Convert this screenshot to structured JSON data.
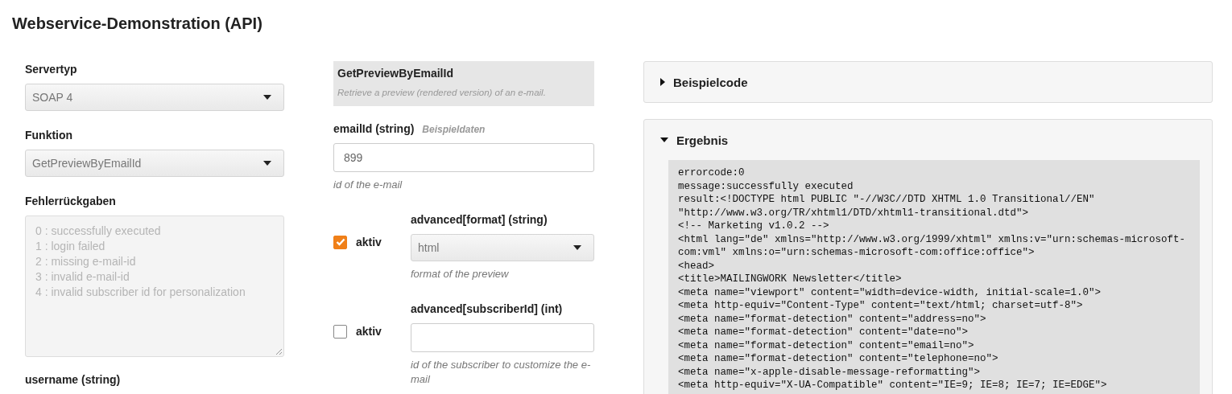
{
  "title": "Webservice-Demonstration (API)",
  "server_type": {
    "label": "Servertyp",
    "value": "SOAP 4"
  },
  "function": {
    "label": "Funktion",
    "value": "GetPreviewByEmailId"
  },
  "errors": {
    "label": "Fehlerrückgaben",
    "lines": [
      "0 : successfully executed",
      "1 : login failed",
      "2 : missing e-mail-id",
      "3 : invalid e-mail-id",
      "4 : invalid subscriber id for personalization"
    ]
  },
  "next_label": "username (string)",
  "function_card": {
    "name": "GetPreviewByEmailId",
    "description": "Retrieve a preview (rendered version) of an e-mail."
  },
  "params": [
    {
      "kind": "input",
      "label": "emailId (string)",
      "sample_link": "Beispieldaten",
      "value": "899",
      "hint": "id of the e-mail"
    },
    {
      "kind": "select",
      "active": {
        "label": "aktiv",
        "checked": true
      },
      "label": "advanced[format] (string)",
      "value": "html",
      "hint": "format of the preview"
    },
    {
      "kind": "input",
      "active": {
        "label": "aktiv",
        "checked": false
      },
      "label": "advanced[subscriberId] (int)",
      "hint": "id of the subscriber to customize the e-mail"
    }
  ],
  "panels": [
    {
      "title": "Beispielcode",
      "expanded": false
    },
    {
      "title": "Ergebnis",
      "expanded": true,
      "code_lines": [
        "errorcode:0",
        "message:successfully executed",
        "result:<!DOCTYPE html PUBLIC \"-//W3C//DTD XHTML 1.0 Transitional//EN\"",
        "\"http://www.w3.org/TR/xhtml1/DTD/xhtml1-transitional.dtd\">",
        "<!-- Marketing v1.0.2 -->",
        "<html lang=\"de\" xmlns=\"http://www.w3.org/1999/xhtml\" xmlns:v=\"urn:schemas-microsoft-com:vml\" xmlns:o=\"urn:schemas-microsoft-com:office:office\">",
        "<head>",
        "<title>MAILINGWORK Newsletter</title>",
        "<meta name=\"viewport\" content=\"width=device-width, initial-scale=1.0\">",
        "<meta http-equiv=\"Content-Type\" content=\"text/html; charset=utf-8\">",
        "<meta name=\"format-detection\" content=\"address=no\">",
        "<meta name=\"format-detection\" content=\"date=no\">",
        "<meta name=\"format-detection\" content=\"email=no\">",
        "<meta name=\"format-detection\" content=\"telephone=no\">",
        "<meta name=\"x-apple-disable-message-reformatting\">",
        "<meta http-equiv=\"X-UA-Compatible\" content=\"IE=9; IE=8; IE=7; IE=EDGE\">"
      ]
    }
  ]
}
